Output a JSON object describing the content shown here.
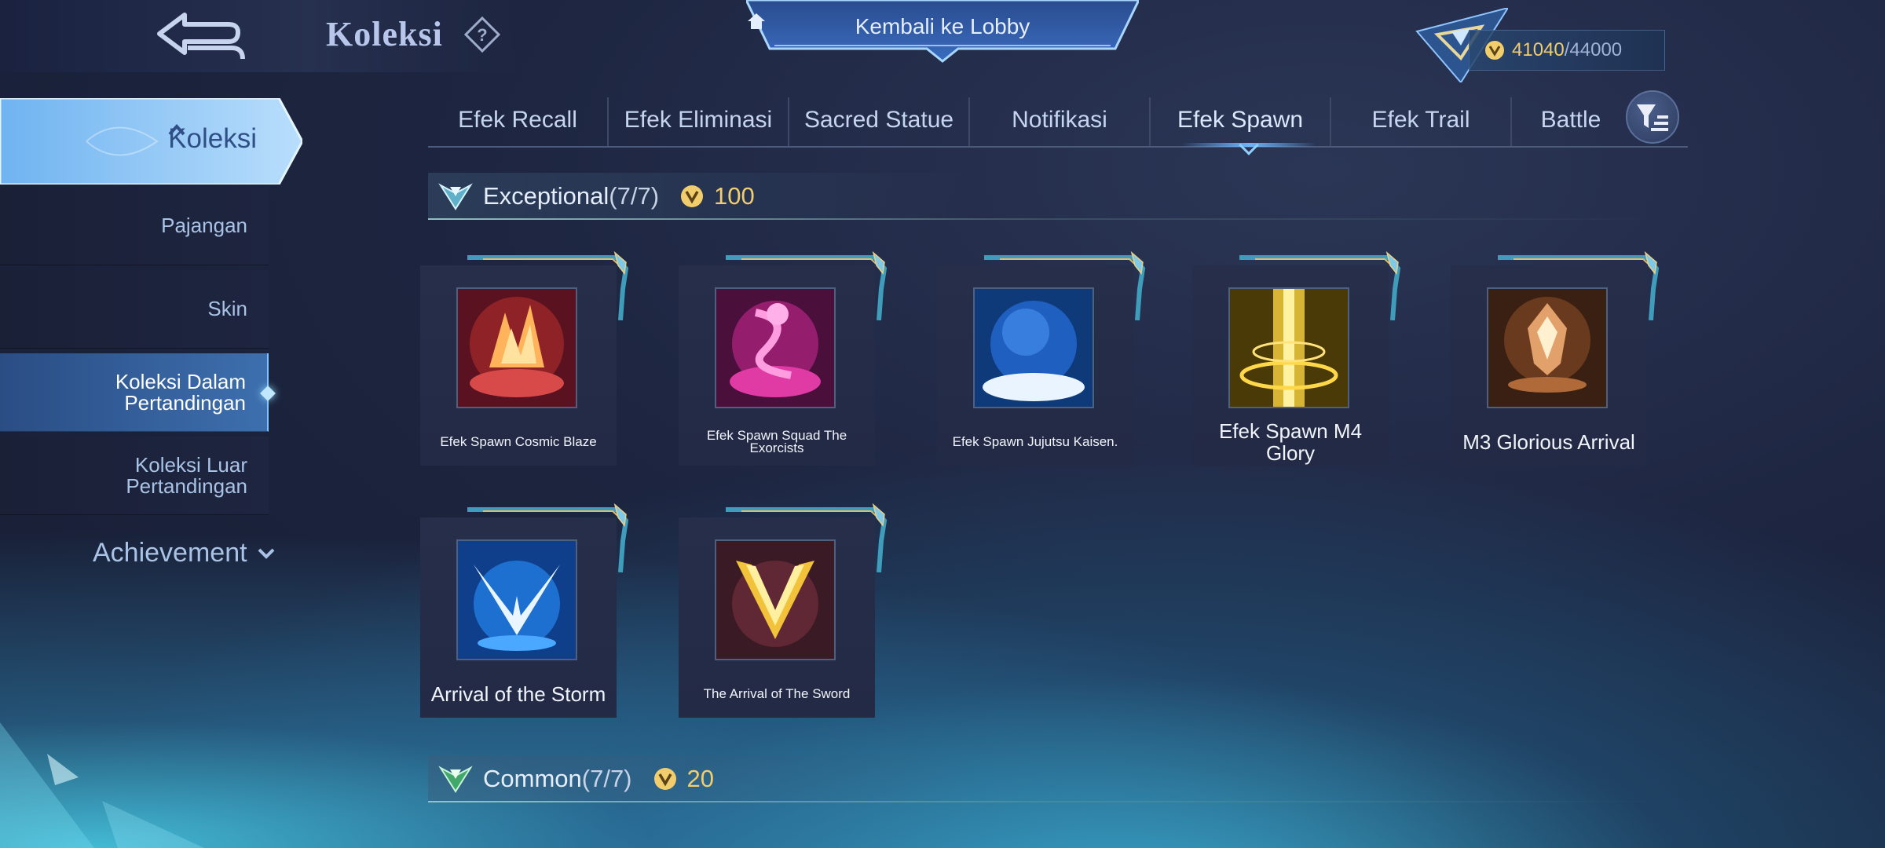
{
  "header": {
    "title": "Koleksi",
    "lobby_label": "Kembali ke Lobby",
    "currency_value": "41040",
    "currency_max": "/44000"
  },
  "sidebar": {
    "main_label": "Koleksi",
    "items": [
      {
        "label": "Pajangan",
        "active": false
      },
      {
        "label": "Skin",
        "active": false
      },
      {
        "label": "Koleksi Dalam\nPertandingan",
        "active": true
      },
      {
        "label": "Koleksi Luar\nPertandingan",
        "active": false
      }
    ],
    "achievement_label": "Achievement"
  },
  "tabs": [
    {
      "label": "Efek Recall"
    },
    {
      "label": "Efek Eliminasi"
    },
    {
      "label": "Sacred Statue"
    },
    {
      "label": "Notifikasi"
    },
    {
      "label": "Efek Spawn",
      "active": true
    },
    {
      "label": "Efek Trail"
    },
    {
      "label": "Battle"
    }
  ],
  "sections": [
    {
      "title": "Exceptional",
      "count": "(7/7)",
      "points": "100",
      "items": [
        {
          "name": "Efek Spawn Cosmic Blaze",
          "icon": "cosmic-blaze-icon"
        },
        {
          "name": "Efek Spawn Squad The Exorcists",
          "icon": "exorcists-icon"
        },
        {
          "name": "Efek Spawn Jujutsu Kaisen.",
          "icon": "jujutsu-orb-icon"
        },
        {
          "name": "Efek Spawn M4 Glory",
          "icon": "m4-glory-icon"
        },
        {
          "name": "M3 Glorious Arrival",
          "icon": "m3-arrival-icon"
        },
        {
          "name": "Arrival of the Storm",
          "icon": "storm-wings-icon"
        },
        {
          "name": "The Arrival of The Sword",
          "icon": "sword-v-icon"
        }
      ]
    },
    {
      "title": "Common",
      "count": "(7/7)",
      "points": "20"
    }
  ],
  "colors": {
    "accent_gold": "#f2cd6d",
    "tab_text": "#c6d5ee",
    "sidebar_active": "#3d6fae",
    "background": "#1d2540"
  }
}
